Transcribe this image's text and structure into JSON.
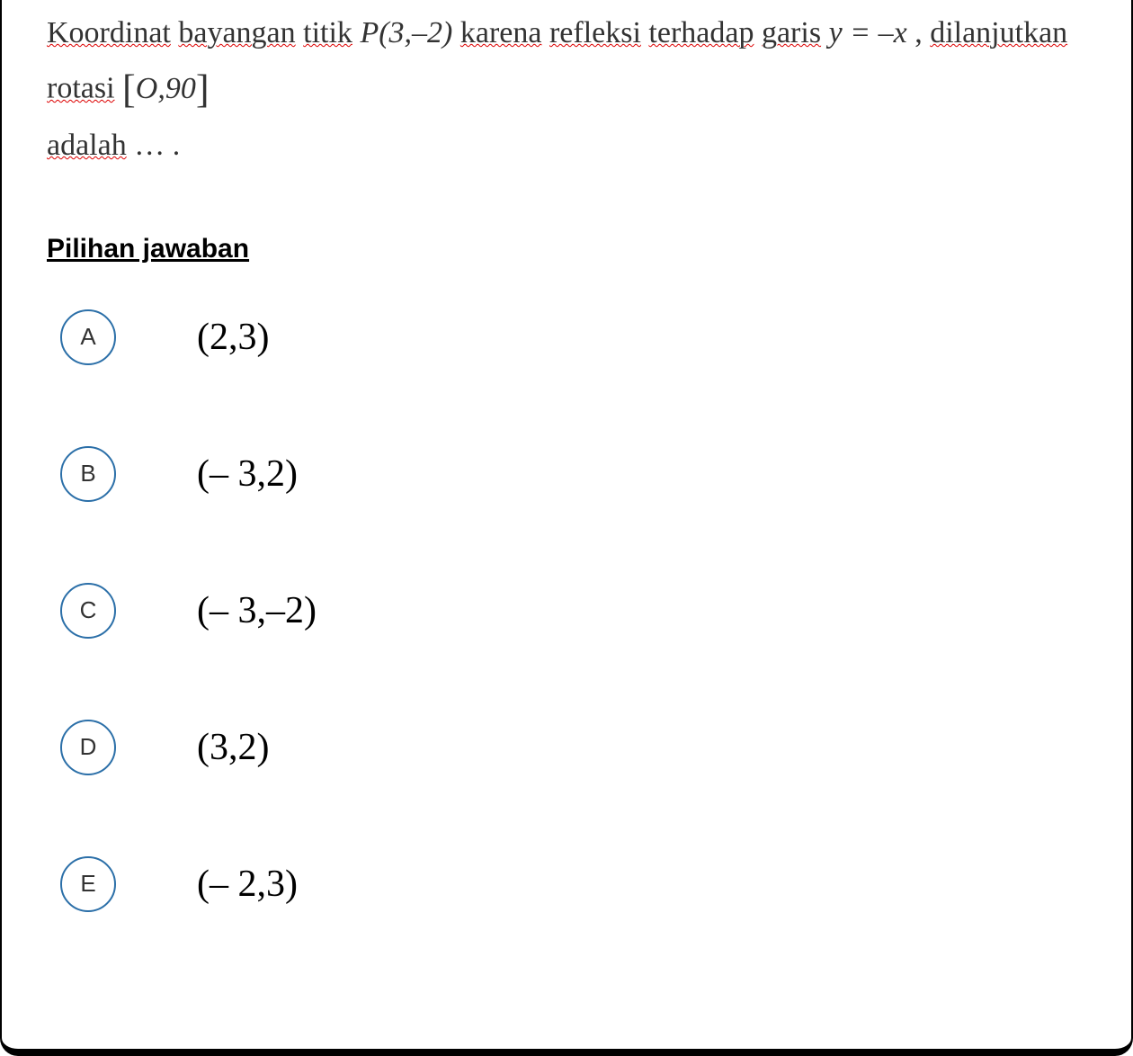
{
  "question": {
    "w1": "Koordinat",
    "w2": "bayangan",
    "w3": "titik",
    "point": "P(3,–2)",
    "w4": "karena",
    "w5": "refleksi",
    "w6": "terhadap",
    "w7": "garis",
    "eq": "y = –x",
    "comma": ",",
    "w8": "dilanjutkan",
    "w9": "rotasi",
    "rot_open": "[",
    "rot_val": "O,90",
    "rot_close": "]",
    "w10": "adalah",
    "dots": "… ."
  },
  "heading": "Pilihan jawaban",
  "options": [
    {
      "letter": "A",
      "value": "(2,3)"
    },
    {
      "letter": "B",
      "value": "(– 3,2)"
    },
    {
      "letter": "C",
      "value": "(– 3,–2)"
    },
    {
      "letter": "D",
      "value": "(3,2)"
    },
    {
      "letter": "E",
      "value": "(– 2,3)"
    }
  ]
}
